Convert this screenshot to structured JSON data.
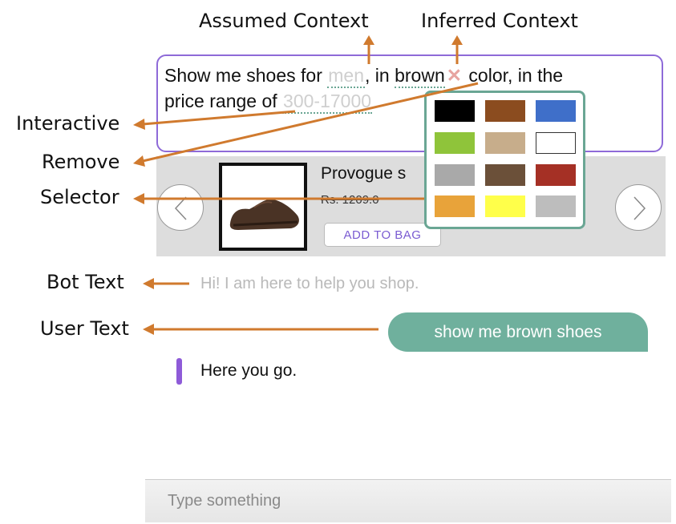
{
  "annotations": {
    "assumed_context": "Assumed Context",
    "inferred_context": "Inferred Context",
    "interactive": "Interactive",
    "remove": "Remove",
    "selector": "Selector",
    "bot_text": "Bot Text",
    "user_text": "User Text"
  },
  "colors": {
    "arrow": "#d07a2e",
    "accent_purple": "#8e6ad8",
    "accent_green": "#6fb09d"
  },
  "context_query": {
    "line1_prefix": "Show me shoes for",
    "assumed_value": "men",
    "line1_mid": ", in",
    "inferred_value": "brown",
    "remove_symbol": "✕",
    "line1_suffix": "color, in the",
    "line2_prefix": "price range of",
    "interactive_value": "300-17000"
  },
  "product": {
    "name": "Provogue s",
    "price": "Rs. 1209.0",
    "add_to_bag": "ADD TO BAG"
  },
  "color_selector": {
    "swatches": [
      "#000000",
      "#8b4c1f",
      "#3f6fc9",
      "#8fc43a",
      "#c7ad8b",
      "#ffffff",
      "#a9a9a9",
      "#6b5039",
      "#a53025",
      "#e8a33a",
      "#ffff4a",
      "#bdbdbd"
    ]
  },
  "chat": {
    "bot_greeting": "Hi! I am here to help you shop.",
    "user_message": "show me brown shoes",
    "bot_reply": "Here you go.",
    "input_placeholder": "Type something"
  }
}
